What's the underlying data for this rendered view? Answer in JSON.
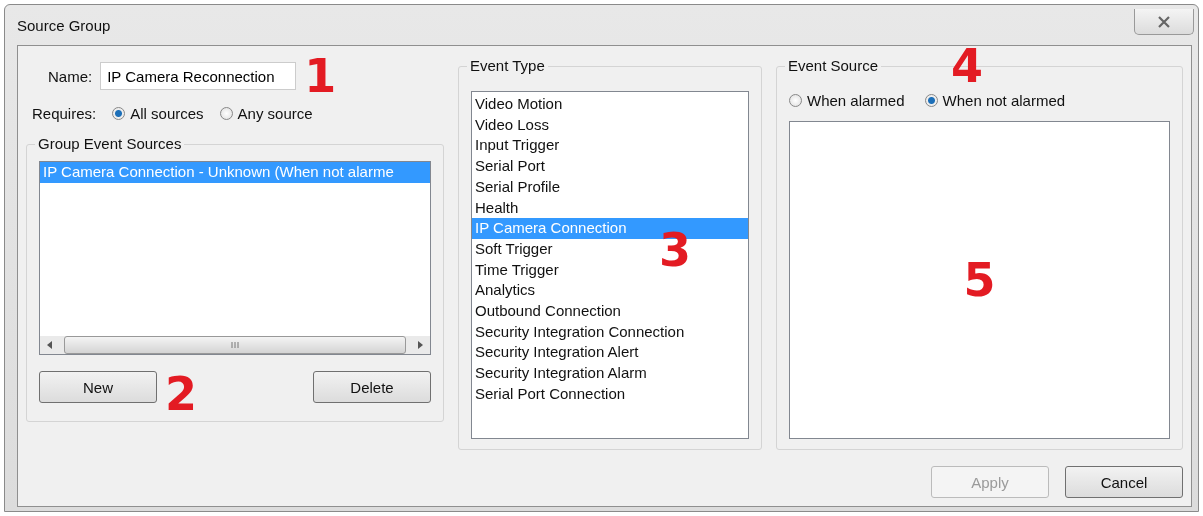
{
  "window": {
    "title": "Source Group"
  },
  "name": {
    "label": "Name:",
    "value": "IP Camera Reconnection"
  },
  "requires": {
    "label": "Requires:",
    "options": [
      {
        "label": "All sources",
        "selected": true
      },
      {
        "label": "Any source",
        "selected": false
      }
    ]
  },
  "group_event_sources": {
    "title": "Group Event Sources",
    "items": [
      {
        "label": "IP Camera Connection - Unknown (When not alarme",
        "selected": true
      }
    ],
    "buttons": [
      "New",
      "Delete"
    ]
  },
  "event_type": {
    "title": "Event Type",
    "items": [
      {
        "label": "Video Motion",
        "selected": false
      },
      {
        "label": "Video Loss",
        "selected": false
      },
      {
        "label": "Input Trigger",
        "selected": false
      },
      {
        "label": "Serial Port",
        "selected": false
      },
      {
        "label": "Serial Profile",
        "selected": false
      },
      {
        "label": "Health",
        "selected": false
      },
      {
        "label": "IP Camera Connection",
        "selected": true
      },
      {
        "label": "Soft Trigger",
        "selected": false
      },
      {
        "label": "Time Trigger",
        "selected": false
      },
      {
        "label": "Analytics",
        "selected": false
      },
      {
        "label": "Outbound Connection",
        "selected": false
      },
      {
        "label": "Security Integration Connection",
        "selected": false
      },
      {
        "label": "Security Integration Alert",
        "selected": false
      },
      {
        "label": "Security Integration Alarm",
        "selected": false
      },
      {
        "label": "Serial Port Connection",
        "selected": false
      }
    ]
  },
  "event_source": {
    "title": "Event Source",
    "options": [
      {
        "label": "When alarmed",
        "selected": false
      },
      {
        "label": "When not alarmed",
        "selected": true
      }
    ]
  },
  "footer_buttons": [
    {
      "label": "Apply",
      "disabled": true
    },
    {
      "label": "Cancel",
      "disabled": false
    }
  ],
  "annotations": [
    "1",
    "2",
    "3",
    "4",
    "5"
  ]
}
